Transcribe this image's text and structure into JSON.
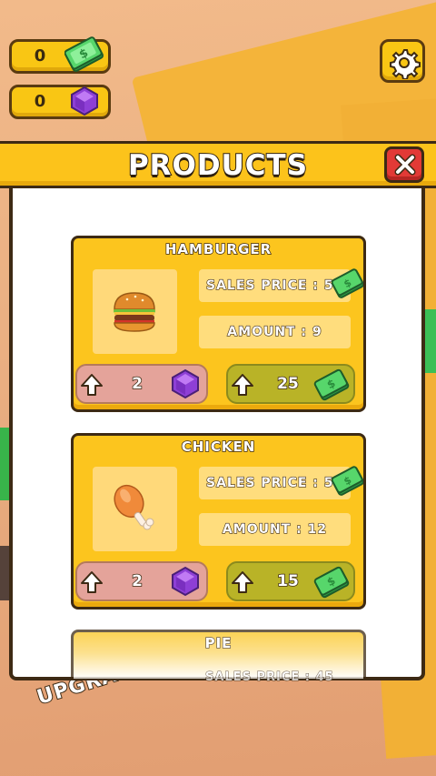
{
  "currencies": {
    "cash": {
      "value": "0",
      "icon": "cash-icon"
    },
    "gems": {
      "value": "0",
      "icon": "gem-icon"
    }
  },
  "settings": {
    "icon": "gear-icon"
  },
  "panel": {
    "title": "PRODUCTS",
    "close_icon": "close-icon"
  },
  "products": [
    {
      "name": "HAMBURGER",
      "icon": "hamburger-icon",
      "sales_price": "SALES PRICE : 5",
      "amount": "AMOUNT : 9",
      "gem_cost": "2",
      "cash_cost": "25"
    },
    {
      "name": "CHICKEN",
      "icon": "chicken-leg-icon",
      "sales_price": "SALES PRICE : 5",
      "amount": "AMOUNT : 12",
      "gem_cost": "2",
      "cash_cost": "15"
    },
    {
      "name": "PIE",
      "sales_price": "SALES PRICE : 45"
    }
  ],
  "world_label": "UPGRADE",
  "colors": {
    "panel_yellow": "#fcc51e",
    "gem_button": "#e4a39a",
    "cash_button": "#b9b327",
    "close_red": "#e23a36",
    "outline": "#3d2a14"
  }
}
